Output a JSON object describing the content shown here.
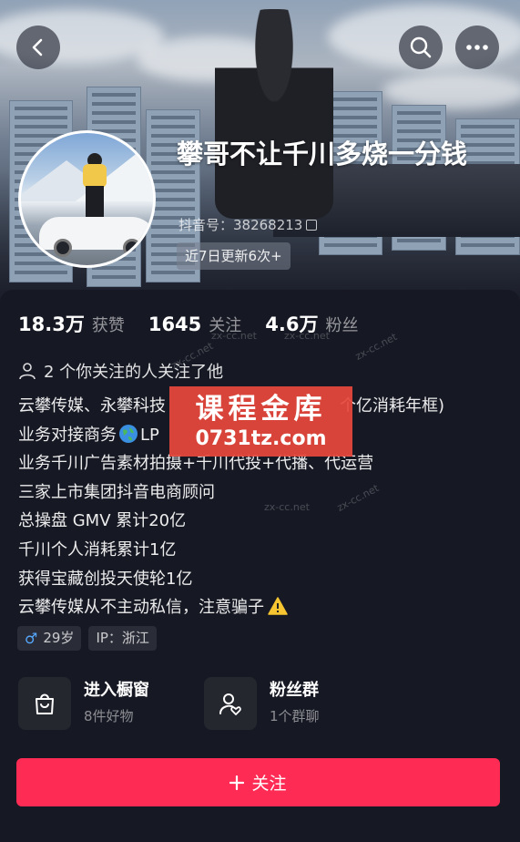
{
  "header": {
    "nickname": "攀哥不让千川多烧一分钱",
    "douyin_id": "抖音号：38268213",
    "update_chip": "近7日更新6次+"
  },
  "stats": [
    {
      "value": "18.3万",
      "label": "获赞"
    },
    {
      "value": "1645",
      "label": "关注"
    },
    {
      "value": "4.6万",
      "label": "粉丝"
    }
  ],
  "mutual_follow": "2 个你关注的人关注了他",
  "bio": [
    "云攀传媒、永攀科技",
    "业务对接商务",
    "业务千川广告素材拍摄+千川代投+代播、代运营",
    "三家上市集团抖音电商顾问",
    "总操盘 GMV 累计20亿",
    "千川个人消耗累计1亿",
    "获得宝藏创投天使轮1亿",
    "云攀传媒从不主动私信，注意骗子"
  ],
  "bio_fragments": {
    "line1_tail": "个亿消耗年框)",
    "line2_tail": "LP"
  },
  "tags": {
    "age": "29岁",
    "ip": "IP：浙江"
  },
  "entries": {
    "shop": {
      "title": "进入橱窗",
      "sub": "8件好物"
    },
    "fans": {
      "title": "粉丝群",
      "sub": "1个群聊"
    }
  },
  "follow_button": "关注",
  "watermark": {
    "title": "课程金库",
    "url": "0731tz.com",
    "small": "zx-cc.net"
  },
  "colors": {
    "background": "#161823",
    "follow": "#fe2c55",
    "gender": "#56a8ff"
  },
  "icons": [
    "back-arrow-icon",
    "search-icon",
    "more-icon",
    "copy-icon",
    "person-icon",
    "globe-icon",
    "warning-icon",
    "male-icon",
    "shopping-bag-icon",
    "fans-group-icon",
    "plus-icon"
  ]
}
